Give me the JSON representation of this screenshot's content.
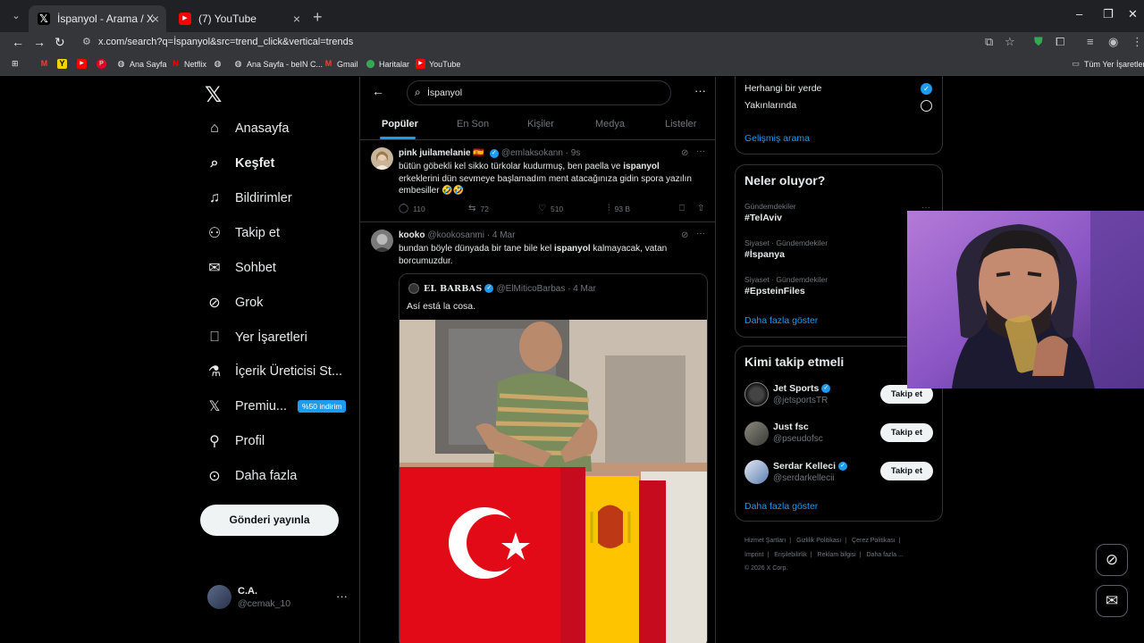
{
  "browser": {
    "tabs": [
      {
        "title": "İspanyol - Arama / X",
        "icon": "x-logo-icon",
        "active": true
      },
      {
        "title": "(7) YouTube",
        "icon": "youtube-icon",
        "active": false
      }
    ],
    "url": "x.com/search?q=İspanyol&src=trend_click&vertical=trends",
    "bookmarks": [
      {
        "label": "",
        "icon": "gmail-icon"
      },
      {
        "label": "",
        "icon": "yellow-app-icon"
      },
      {
        "label": "",
        "icon": "youtube-icon"
      },
      {
        "label": "",
        "icon": "pinterest-icon"
      },
      {
        "label": "Ana Sayfa",
        "icon": "globe-icon"
      },
      {
        "label": "Netflix",
        "icon": "netflix-icon"
      },
      {
        "label": "",
        "icon": "globe-icon"
      },
      {
        "label": "Ana Sayfa - beIN C...",
        "icon": "globe-icon"
      },
      {
        "label": "Gmail",
        "icon": "gmail-icon"
      },
      {
        "label": "Haritalar",
        "icon": "maps-icon"
      },
      {
        "label": "YouTube",
        "icon": "youtube-icon"
      }
    ],
    "all_bookmarks": "Tüm Yer İşaretleri"
  },
  "nav": {
    "items": [
      {
        "label": "Anasayfa",
        "icon": "home-icon"
      },
      {
        "label": "Keşfet",
        "icon": "search-icon"
      },
      {
        "label": "Bildirimler",
        "icon": "bell-icon"
      },
      {
        "label": "Takip et",
        "icon": "add-user-icon"
      },
      {
        "label": "Sohbet",
        "icon": "mail-icon"
      },
      {
        "label": "Grok",
        "icon": "grok-icon"
      },
      {
        "label": "Yer İşaretleri",
        "icon": "bookmark-icon"
      },
      {
        "label": "İçerik Üreticisi St...",
        "icon": "flask-icon"
      },
      {
        "label": "Premiu...",
        "icon": "x-logo-icon"
      },
      {
        "label": "Profil",
        "icon": "person-icon"
      },
      {
        "label": "Daha fazla",
        "icon": "more-circle-icon"
      }
    ],
    "premium_badge": "%50 indirim",
    "post_button": "Gönderi yayınla",
    "account": {
      "name": "C.A.",
      "handle": "@cemak_10"
    }
  },
  "search": {
    "query": "İspanyol",
    "tabs": [
      "Popüler",
      "En Son",
      "Kişiler",
      "Medya",
      "Listeler"
    ]
  },
  "tweets": [
    {
      "name": "pink juilamelanie 🇪🇸",
      "handle": "@emlaksokann",
      "time": "9s",
      "text_before": "bütün göbekli kel sikko türkolar kudurmuş, ben paella ve ",
      "highlight": "ispanyol",
      "text_after": " erkeklerini dün sevmeye başlamadım ment atacağınıza gidin spora yazılın embesiller 🤣🤣",
      "replies": "110",
      "retweets": "72",
      "likes": "510",
      "views": "93 B"
    },
    {
      "name": "kooko",
      "handle": "@kookosanmi",
      "time": "4 Mar",
      "text_before": "bundan böyle dünyada bir tane bile kel ",
      "highlight": "ispanyol",
      "text_after": " kalmayacak, vatan borcumuzdur.",
      "quote": {
        "name": "EL BARBAS",
        "handle": "@ElMiticoBarbas",
        "time": "4 Mar",
        "text": "Así está la cosa."
      }
    }
  ],
  "sidebar": {
    "location": {
      "options": [
        "Herhangi bir yerde",
        "Yakınlarında"
      ],
      "advanced": "Gelişmiş arama"
    },
    "trends": {
      "title": "Neler oluyor?",
      "items": [
        {
          "meta": "Gündemdekiler",
          "name": "#TelAviv"
        },
        {
          "meta": "Siyaset · Gündemdekiler",
          "name": "#İspanya"
        },
        {
          "meta": "Siyaset · Gündemdekiler",
          "name": "#EpsteinFiles"
        }
      ],
      "show_more": "Daha fazla göster"
    },
    "who": {
      "title": "Kimi takip etmeli",
      "items": [
        {
          "name": "Jet Sports",
          "handle": "@jetsportsTR",
          "verified": true
        },
        {
          "name": "Just fsc",
          "handle": "@pseudofsc",
          "verified": false
        },
        {
          "name": "Serdar Kelleci",
          "handle": "@serdarkellecii",
          "verified": true
        }
      ],
      "follow_label": "Takip et",
      "show_more": "Daha fazla göster"
    },
    "footer": {
      "line1": [
        "Hizmet Şartları",
        "Gizlilik Politikası",
        "Çerez Politikası"
      ],
      "line2": [
        "Imprint",
        "Erişilebilirlik",
        "Reklam bilgisi",
        "Daha fazla ..."
      ],
      "copyright": "© 2026 X Corp."
    }
  },
  "colors": {
    "accent": "#1d9bf0",
    "background": "#000000",
    "muted": "#71767b"
  }
}
